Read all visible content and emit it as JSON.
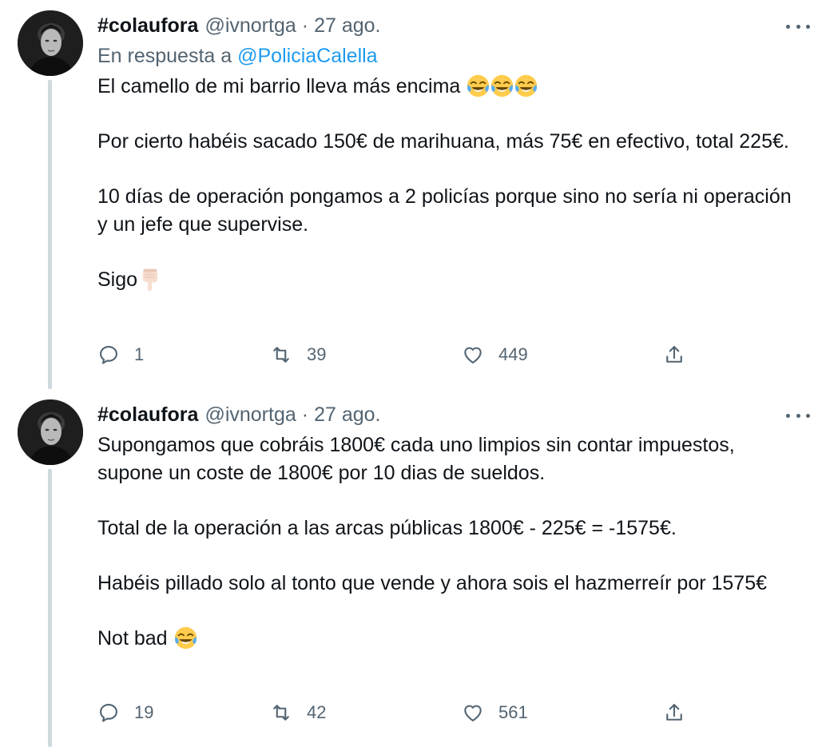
{
  "tweets": [
    {
      "author_name": "#colaufora",
      "handle": "@ivnortga",
      "separator": "·",
      "date": "27 ago.",
      "reply_prefix": "En respuesta a",
      "reply_mention": "@PoliciaCalella",
      "paragraphs": [
        "El camello de mi barrio lleva más encima",
        "Por cierto habéis sacado 150€ de marihuana, más 75€ en efectivo, total 225€.",
        "10 días de operación pongamos a 2 policías porque sino no sería ni operación y un jefe que supervise.",
        "Sigo"
      ],
      "emoji_icons": [
        "joy-emoji",
        "joy-emoji",
        "joy-emoji",
        "point-down-emoji"
      ],
      "replies": "1",
      "retweets": "39",
      "likes": "449"
    },
    {
      "author_name": "#colaufora",
      "handle": "@ivnortga",
      "separator": "·",
      "date": "27 ago.",
      "paragraphs": [
        "Supongamos que cobráis 1800€ cada uno limpios sin contar impuestos, supone un coste de 1800€ por 10 dias de sueldos.",
        "Total de la operación a las arcas públicas 1800€ - 225€ = -1575€.",
        "Habéis pillado solo al tonto que vende y ahora sois el hazmerreír por 1575€",
        "Not bad"
      ],
      "emoji_icons": [
        "joy-emoji"
      ],
      "replies": "19",
      "retweets": "42",
      "likes": "561"
    }
  ],
  "icons": {
    "more": "more-horizontal-icon",
    "reply": "reply-icon",
    "retweet": "retweet-icon",
    "like": "heart-icon",
    "share": "share-icon"
  },
  "colors": {
    "text": "#0f1419",
    "secondary": "#536471",
    "link": "#1d9bf0",
    "thread_line": "#cfd9de"
  }
}
